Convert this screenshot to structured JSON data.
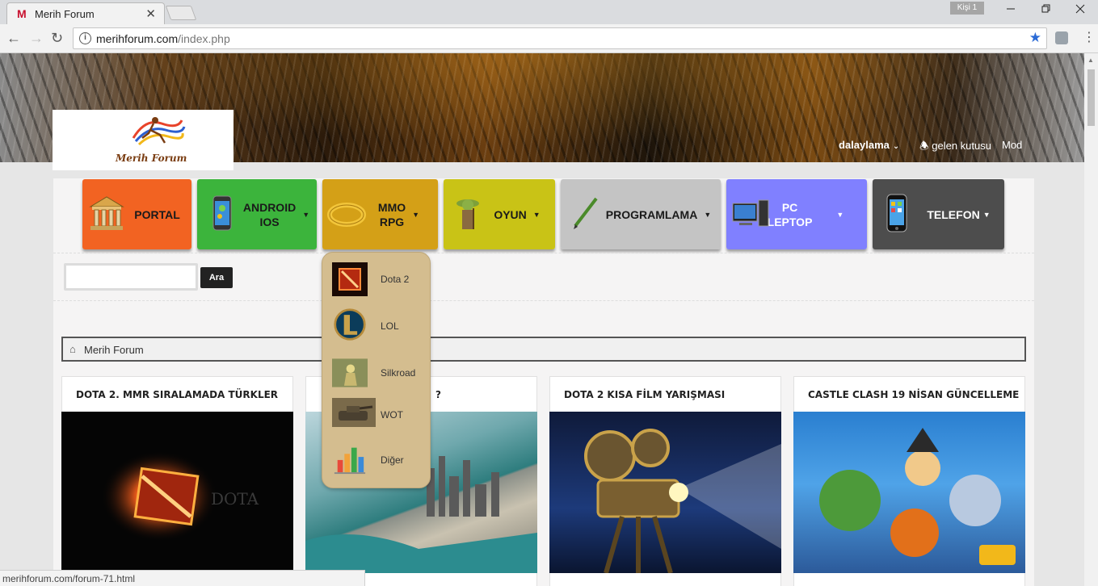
{
  "browser": {
    "tab_title": "Merih Forum",
    "tab_favicon": "M",
    "tab_close": "✕",
    "profile_label": "Kişi 1",
    "url_domain": "merihforum.com",
    "url_path": "/index.php",
    "info_symbol": "i",
    "status_url": "merihforum.com/forum-71.html"
  },
  "header": {
    "logo_text": "Merih Forum",
    "user_name": "dalaylama",
    "inbox_label": "gelen kutusu",
    "mod_label": "Mod"
  },
  "nav": [
    {
      "label": "PORTAL",
      "has_caret": false,
      "bg": "#f26322",
      "color": "#1a1a1a",
      "icon": "building-icon"
    },
    {
      "label": "ANDROID\nIOS",
      "has_caret": true,
      "bg": "#3cb43c",
      "color": "#1a1a1a",
      "icon": "phone-icon"
    },
    {
      "label": "MMO\nRPG",
      "has_caret": true,
      "bg": "#d4a017",
      "color": "#1a1a1a",
      "icon": "ring-icon"
    },
    {
      "label": "OYUN",
      "has_caret": true,
      "bg": "#c9c316",
      "color": "#1a1a1a",
      "icon": "yoda-icon"
    },
    {
      "label": "PROGRAMLAMA",
      "has_caret": true,
      "bg": "#c4c4c4",
      "color": "#1a1a1a",
      "icon": "pencil-icon"
    },
    {
      "label": "PC\nLEPTOP",
      "has_caret": true,
      "bg": "#8080ff",
      "color": "#ffffff",
      "icon": "computer-icon"
    },
    {
      "label": "TELEFON",
      "has_caret": true,
      "bg": "#4d4d4d",
      "color": "#ffffff",
      "icon": "iphone-icon"
    }
  ],
  "search": {
    "button_label": "Ara",
    "value": ""
  },
  "breadcrumb": {
    "label": "Merih Forum"
  },
  "cards": [
    {
      "title": "DOTA 2. MMR SIRALAMADA TÜRKLER"
    },
    {
      "title": "?"
    },
    {
      "title": "DOTA 2 KISA FİLM YARIŞMASI"
    },
    {
      "title": "CASTLE CLASH 19 NİSAN GÜNCELLEME"
    }
  ],
  "dropdown": {
    "items": [
      {
        "label": "Dota 2"
      },
      {
        "label": "LOL"
      },
      {
        "label": "Silkroad"
      },
      {
        "label": "WOT"
      },
      {
        "label": "Diğer"
      }
    ]
  },
  "colors": {
    "dropdown_bg": "#d4bd8f",
    "star": "#2b6bd6"
  }
}
